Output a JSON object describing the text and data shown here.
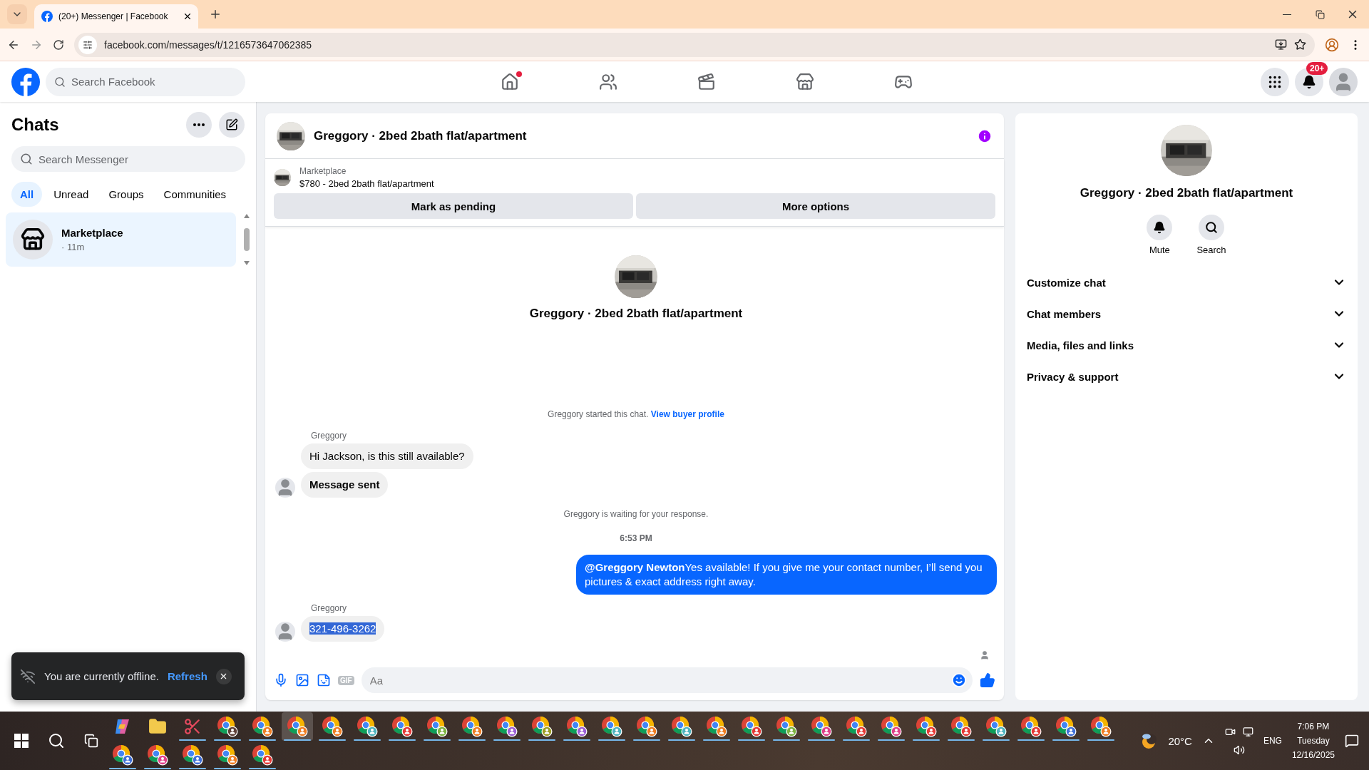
{
  "browser": {
    "tab_title": "(20+) Messenger | Facebook",
    "url": "facebook.com/messages/t/1216573647062385"
  },
  "facebook": {
    "search": {
      "placeholder": "Search Facebook"
    },
    "nav": [
      {
        "kind": "home",
        "dot": true
      },
      {
        "kind": "friends",
        "dot": false
      },
      {
        "kind": "video",
        "dot": false
      },
      {
        "kind": "marketplace",
        "dot": false
      },
      {
        "kind": "gaming",
        "dot": false
      }
    ],
    "notifications_badge": "20+"
  },
  "sidebar": {
    "title": "Chats",
    "search": {
      "placeholder": "Search Messenger"
    },
    "filters": [
      {
        "label": "All",
        "selected": true
      },
      {
        "label": "Unread",
        "selected": false
      },
      {
        "label": "Groups",
        "selected": false
      },
      {
        "label": "Communities",
        "selected": false
      }
    ],
    "chats": [
      {
        "name": "Marketplace",
        "meta": "· 11m",
        "selected": true
      }
    ],
    "toast": {
      "text": "You are currently offline.",
      "action": "Refresh"
    }
  },
  "chat": {
    "title": "Greggory · 2bed 2bath flat/apartment",
    "listing": {
      "source": "Marketplace",
      "title": "$780 - 2bed 2bath flat/apartment"
    },
    "actions": [
      "Mark as pending",
      "More options"
    ],
    "intro_name": "Greggory · 2bed 2bath flat/apartment",
    "messages": [
      {
        "kind": "system",
        "text": "Greggory started this chat.",
        "link": "View buyer profile"
      },
      {
        "kind": "incoming",
        "sender": "Greggory",
        "bubbles": [
          {
            "text": "Hi Jackson, is this still available?",
            "bold": false,
            "highlighted": false
          },
          {
            "text": "Message sent",
            "bold": true,
            "highlighted": false
          }
        ]
      },
      {
        "kind": "system",
        "text": "Greggory is waiting for your response."
      },
      {
        "kind": "time",
        "text": "6:53 PM"
      },
      {
        "kind": "outgoing",
        "text": "**@Greggory Newton**Yes available! If you give me your contact number, I’ll send you pictures & exact address right away."
      },
      {
        "kind": "incoming",
        "sender": "Greggory",
        "bubbles": [
          {
            "text": "321-496-3262",
            "bold": false,
            "highlighted": true
          }
        ]
      }
    ],
    "composer": {
      "placeholder": "Aa",
      "gif_label": "GIF"
    }
  },
  "details": {
    "name": "Greggory · 2bed 2bath flat/apartment",
    "actions": [
      {
        "kind": "mute",
        "label": "Mute"
      },
      {
        "kind": "search",
        "label": "Search"
      }
    ],
    "sections": [
      {
        "label": "Customize chat",
        "expanded": false
      },
      {
        "label": "Chat members",
        "expanded": false
      },
      {
        "label": "Media, files and links",
        "expanded": false
      },
      {
        "label": "Privacy & support",
        "expanded": false
      }
    ]
  },
  "taskbar": {
    "apps": [
      {
        "kind": "copilot",
        "running": false,
        "selected": false
      },
      {
        "kind": "files",
        "running": false,
        "selected": false
      },
      {
        "kind": "snip",
        "running": true,
        "selected": false
      },
      {
        "kind": "browser",
        "color": "#5d4037",
        "running": true,
        "selected": false
      },
      {
        "kind": "browser",
        "color": "#ef7d22",
        "running": true,
        "selected": false
      },
      {
        "kind": "browser",
        "color": "#ef7d22",
        "running": true,
        "selected": true
      },
      {
        "kind": "browser",
        "color": "#ef7d22",
        "running": true,
        "selected": false
      },
      {
        "kind": "browser",
        "color": "#4fb3bf",
        "running": true,
        "selected": false
      },
      {
        "kind": "browser",
        "color": "#e53935",
        "running": true,
        "selected": false
      },
      {
        "kind": "browser",
        "color": "#7cb342",
        "running": true,
        "selected": false
      },
      {
        "kind": "browser",
        "color": "#ef7d22",
        "running": true,
        "selected": false
      },
      {
        "kind": "browser",
        "color": "#9c5fd6",
        "running": true,
        "selected": false
      },
      {
        "kind": "browser",
        "color": "#9e9d24",
        "running": true,
        "selected": false
      },
      {
        "kind": "browser",
        "color": "#9c5fd6",
        "running": true,
        "selected": false
      },
      {
        "kind": "browser",
        "color": "#4fb3bf",
        "running": true,
        "selected": false
      },
      {
        "kind": "browser",
        "color": "#ef7d22",
        "running": true,
        "selected": false
      },
      {
        "kind": "browser",
        "color": "#4fb3bf",
        "running": true,
        "selected": false
      },
      {
        "kind": "browser",
        "color": "#ef7d22",
        "running": true,
        "selected": false
      },
      {
        "kind": "browser",
        "color": "#e53935",
        "running": true,
        "selected": false
      },
      {
        "kind": "browser",
        "color": "#7cb342",
        "running": true,
        "selected": false
      },
      {
        "kind": "browser",
        "color": "#e0408a",
        "running": true,
        "selected": false
      },
      {
        "kind": "browser",
        "color": "#e53935",
        "running": true,
        "selected": false
      },
      {
        "kind": "browser",
        "color": "#e0408a",
        "running": true,
        "selected": false
      },
      {
        "kind": "browser",
        "color": "#e53935",
        "running": true,
        "selected": false
      },
      {
        "kind": "browser",
        "color": "#e53935",
        "running": true,
        "selected": false
      },
      {
        "kind": "browser",
        "color": "#4fb3bf",
        "running": true,
        "selected": false
      },
      {
        "kind": "browser",
        "color": "#e53935",
        "running": true,
        "selected": false
      },
      {
        "kind": "browser",
        "color": "#3f6fd8",
        "running": true,
        "selected": false
      },
      {
        "kind": "browser",
        "color": "#ef7d22",
        "running": true,
        "selected": false
      },
      {
        "kind": "browser",
        "color": "#3f6fd8",
        "running": true,
        "selected": false
      },
      {
        "kind": "browser",
        "color": "#e0408a",
        "running": true,
        "selected": false
      },
      {
        "kind": "browser",
        "color": "#3f6fd8",
        "running": true,
        "selected": false
      },
      {
        "kind": "browser",
        "color": "#ef7d22",
        "running": true,
        "selected": false
      },
      {
        "kind": "browser",
        "color": "#e53935",
        "running": true,
        "selected": false
      }
    ],
    "weather": "20°C",
    "language": "ENG",
    "time": "7:06 PM",
    "day": "Tuesday",
    "date": "12/16/2025"
  }
}
